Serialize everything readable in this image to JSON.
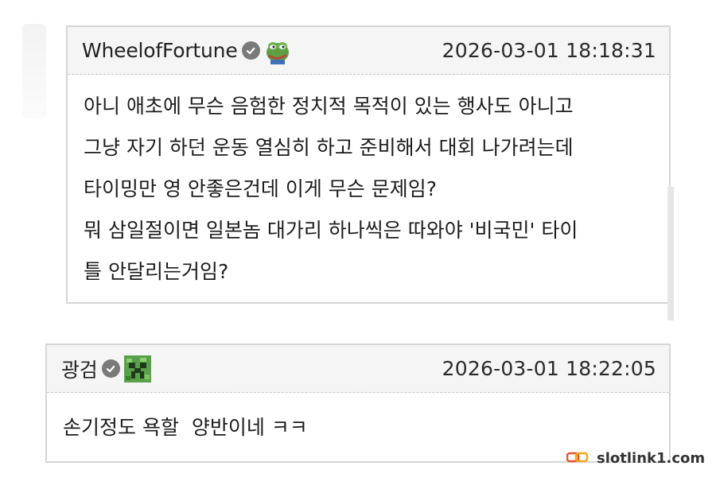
{
  "comments": [
    {
      "nickname": "WheelofFortune",
      "badge_icon": "pepe-frog-icon",
      "timestamp": "2026-03-01 18:18:31",
      "lines": [
        "아니 애초에 무슨 음험한 정치적 목적이 있는 행사도 아니고",
        "그냥 자기 하던 운동 열심히 하고 준비해서 대회 나가려는데",
        "타이밍만 영 안좋은건데 이게 무슨 문제임?",
        "뭐 삼일절이면 일본놈 대가리 하나씩은 따와야 '비국민' 타이",
        "틀 안달리는거임?"
      ]
    },
    {
      "nickname": "광검",
      "badge_icon": "creeper-icon",
      "timestamp": "2026-03-01 18:22:05",
      "lines": [
        "손기정도 욕할  양반이네 ㅋㅋ"
      ]
    }
  ],
  "watermark": {
    "text": "slotlink1.com",
    "icon": "slotlink-logo-icon"
  },
  "colors": {
    "border": "#d6d6d6",
    "header_bg": "#f5f5f5",
    "verified": "#7a7a7a"
  }
}
